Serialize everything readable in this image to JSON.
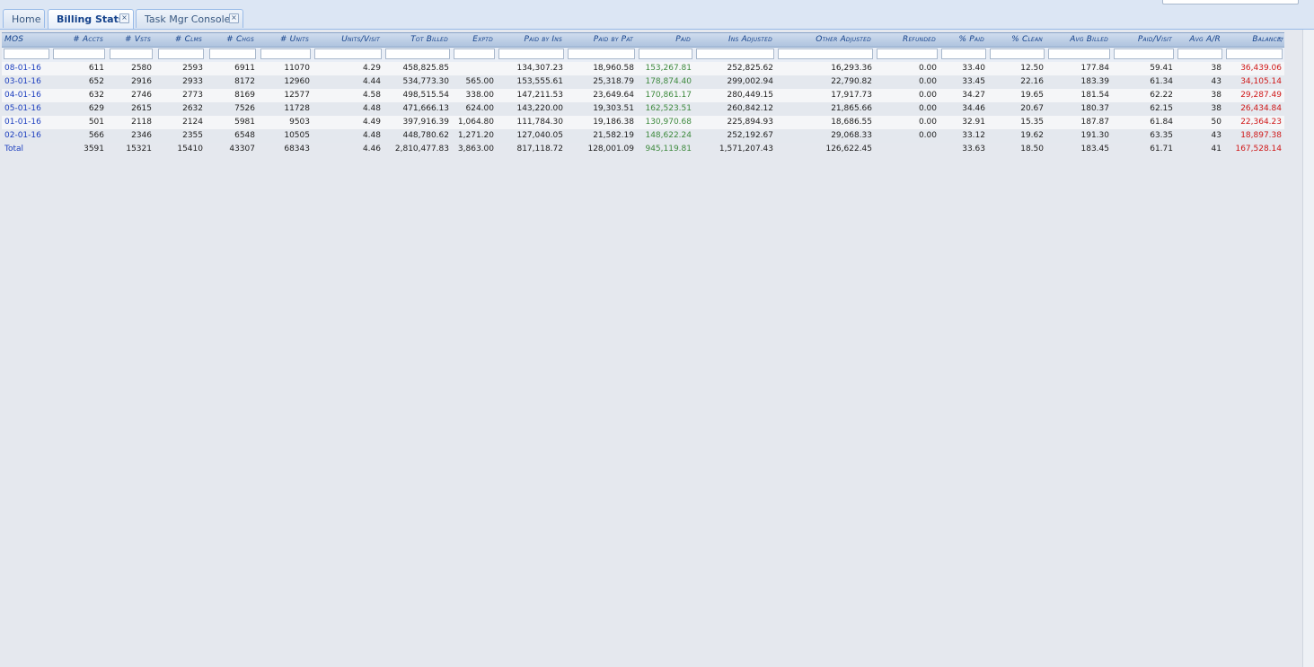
{
  "tabs": [
    {
      "label": "Home",
      "active": false,
      "closable": false
    },
    {
      "label": "Billing Stats",
      "active": true,
      "closable": true
    },
    {
      "label": "Task Mgr Console*",
      "active": false,
      "closable": true
    }
  ],
  "columns": [
    "MOS",
    "# Accts",
    "# Vsts",
    "# Clms",
    "# Chgs",
    "# Units",
    "Units/Visit",
    "Tot Billed",
    "Exptd",
    "Paid by Ins",
    "Paid by Pat",
    "Paid",
    "Ins Adjusted",
    "Other Adjusted",
    "Refunded",
    "% Paid",
    "% Clean",
    "Avg Billed",
    "Paid/Visit",
    "Avg A/R",
    "Balance"
  ],
  "rows": [
    [
      "08-01-16",
      "611",
      "2580",
      "2593",
      "6911",
      "11070",
      "4.29",
      "458,825.85",
      "",
      "134,307.23",
      "18,960.58",
      "153,267.81",
      "252,825.62",
      "16,293.36",
      "0.00",
      "33.40",
      "12.50",
      "177.84",
      "59.41",
      "38",
      "36,439.06"
    ],
    [
      "03-01-16",
      "652",
      "2916",
      "2933",
      "8172",
      "12960",
      "4.44",
      "534,773.30",
      "565.00",
      "153,555.61",
      "25,318.79",
      "178,874.40",
      "299,002.94",
      "22,790.82",
      "0.00",
      "33.45",
      "22.16",
      "183.39",
      "61.34",
      "43",
      "34,105.14"
    ],
    [
      "04-01-16",
      "632",
      "2746",
      "2773",
      "8169",
      "12577",
      "4.58",
      "498,515.54",
      "338.00",
      "147,211.53",
      "23,649.64",
      "170,861.17",
      "280,449.15",
      "17,917.73",
      "0.00",
      "34.27",
      "19.65",
      "181.54",
      "62.22",
      "38",
      "29,287.49"
    ],
    [
      "05-01-16",
      "629",
      "2615",
      "2632",
      "7526",
      "11728",
      "4.48",
      "471,666.13",
      "624.00",
      "143,220.00",
      "19,303.51",
      "162,523.51",
      "260,842.12",
      "21,865.66",
      "0.00",
      "34.46",
      "20.67",
      "180.37",
      "62.15",
      "38",
      "26,434.84"
    ],
    [
      "01-01-16",
      "501",
      "2118",
      "2124",
      "5981",
      "9503",
      "4.49",
      "397,916.39",
      "1,064.80",
      "111,784.30",
      "19,186.38",
      "130,970.68",
      "225,894.93",
      "18,686.55",
      "0.00",
      "32.91",
      "15.35",
      "187.87",
      "61.84",
      "50",
      "22,364.23"
    ],
    [
      "02-01-16",
      "566",
      "2346",
      "2355",
      "6548",
      "10505",
      "4.48",
      "448,780.62",
      "1,271.20",
      "127,040.05",
      "21,582.19",
      "148,622.24",
      "252,192.67",
      "29,068.33",
      "0.00",
      "33.12",
      "19.62",
      "191.30",
      "63.35",
      "43",
      "18,897.38"
    ]
  ],
  "total": [
    "Total",
    "3591",
    "15321",
    "15410",
    "43307",
    "68343",
    "4.46",
    "2,810,477.83",
    "3,863.00",
    "817,118.72",
    "128,001.09",
    "945,119.81",
    "1,571,207.43",
    "126,622.45",
    "",
    "33.63",
    "18.50",
    "183.45",
    "61.71",
    "41",
    "167,528.14"
  ],
  "colors": {
    "mos_link": "#1d3fbf",
    "paid": "#3e8a3e",
    "balance": "#d01818",
    "header_text": "#15428b"
  },
  "icons": {
    "tab_close": "close-icon",
    "sort": "sort-desc-icon"
  }
}
